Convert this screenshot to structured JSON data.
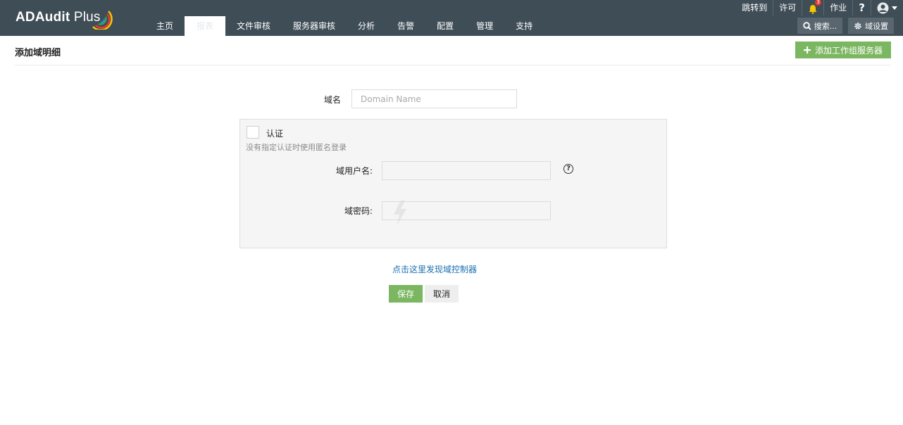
{
  "brand": {
    "name_bold": "ADAudit",
    "name_light": " Plus"
  },
  "nav": {
    "tabs": [
      {
        "label": "主页"
      },
      {
        "label": "报表"
      },
      {
        "label": "文件审核"
      },
      {
        "label": "服务器审核"
      },
      {
        "label": "分析"
      },
      {
        "label": "告警"
      },
      {
        "label": "配置"
      },
      {
        "label": "管理"
      },
      {
        "label": "支持"
      }
    ],
    "active_index": 1
  },
  "toplinks": {
    "jump": "跳转到",
    "license": "许可",
    "notifications_count": "3",
    "jobs": "作业",
    "help": "?"
  },
  "toolbar": {
    "search_label": "搜索...",
    "domain_settings_label": "域设置"
  },
  "page": {
    "title": "添加域明细",
    "add_workgroup_label": "添加工作组服务器"
  },
  "form": {
    "domain_label": "域名",
    "domain_placeholder": "Domain Name",
    "domain_value": "",
    "auth_label": "认证",
    "auth_hint": "没有指定认证时使用匿名登录",
    "username_label": "域用户名:",
    "password_label": "域密码:",
    "discover_link": "点击这里发现域控制器",
    "save_label": "保存",
    "cancel_label": "取消"
  },
  "colors": {
    "topbar": "#3f4d57",
    "primary_green": "#7bb661",
    "link_blue": "#1a6fb0"
  }
}
